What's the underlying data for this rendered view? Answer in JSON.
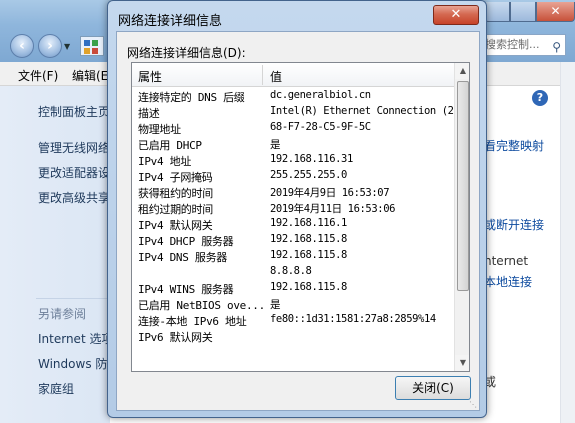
{
  "background": {
    "search_placeholder": "搜索控制...",
    "menu": [
      "文件(F)",
      "编辑(E)"
    ],
    "sidebar_links": [
      "控制面板主页",
      "管理无线网络",
      "更改适配器设置",
      "更改高级共享设置"
    ],
    "see_also_label": "另请参阅",
    "see_also_links": [
      "Internet 选项",
      "Windows 防火墙",
      "家庭组"
    ],
    "content_links": [
      "看完整映射",
      "或断开连接",
      "本地连接"
    ],
    "content_text": [
      "nternet",
      "或"
    ]
  },
  "dialog": {
    "title": "网络连接详细信息",
    "label": "网络连接详细信息(D):",
    "columns": [
      "属性",
      "值"
    ],
    "rows": [
      {
        "p": "连接特定的 DNS 后缀",
        "v": "dc.generalbiol.cn"
      },
      {
        "p": "描述",
        "v": "Intel(R) Ethernet Connection (2"
      },
      {
        "p": "物理地址",
        "v": "68-F7-28-C5-9F-5C"
      },
      {
        "p": "已启用 DHCP",
        "v": "是"
      },
      {
        "p": "IPv4 地址",
        "v": "192.168.116.31"
      },
      {
        "p": "IPv4 子网掩码",
        "v": "255.255.255.0"
      },
      {
        "p": "获得租约的时间",
        "v": "2019年4月9日 16:53:07"
      },
      {
        "p": "租约过期的时间",
        "v": "2019年4月11日 16:53:06"
      },
      {
        "p": "IPv4 默认网关",
        "v": "192.168.116.1"
      },
      {
        "p": "IPv4 DHCP 服务器",
        "v": "192.168.115.8"
      },
      {
        "p": "IPv4 DNS 服务器",
        "v": "192.168.115.8"
      },
      {
        "p": "",
        "v": "8.8.8.8"
      },
      {
        "p": "IPv4 WINS 服务器",
        "v": "192.168.115.8"
      },
      {
        "p": "已启用 NetBIOS ove...",
        "v": "是"
      },
      {
        "p": "连接-本地 IPv6 地址",
        "v": "fe80::1d31:1581:27a8:2859%14"
      },
      {
        "p": "IPv6 默认网关",
        "v": ""
      }
    ],
    "close_button": "关闭(C)"
  }
}
